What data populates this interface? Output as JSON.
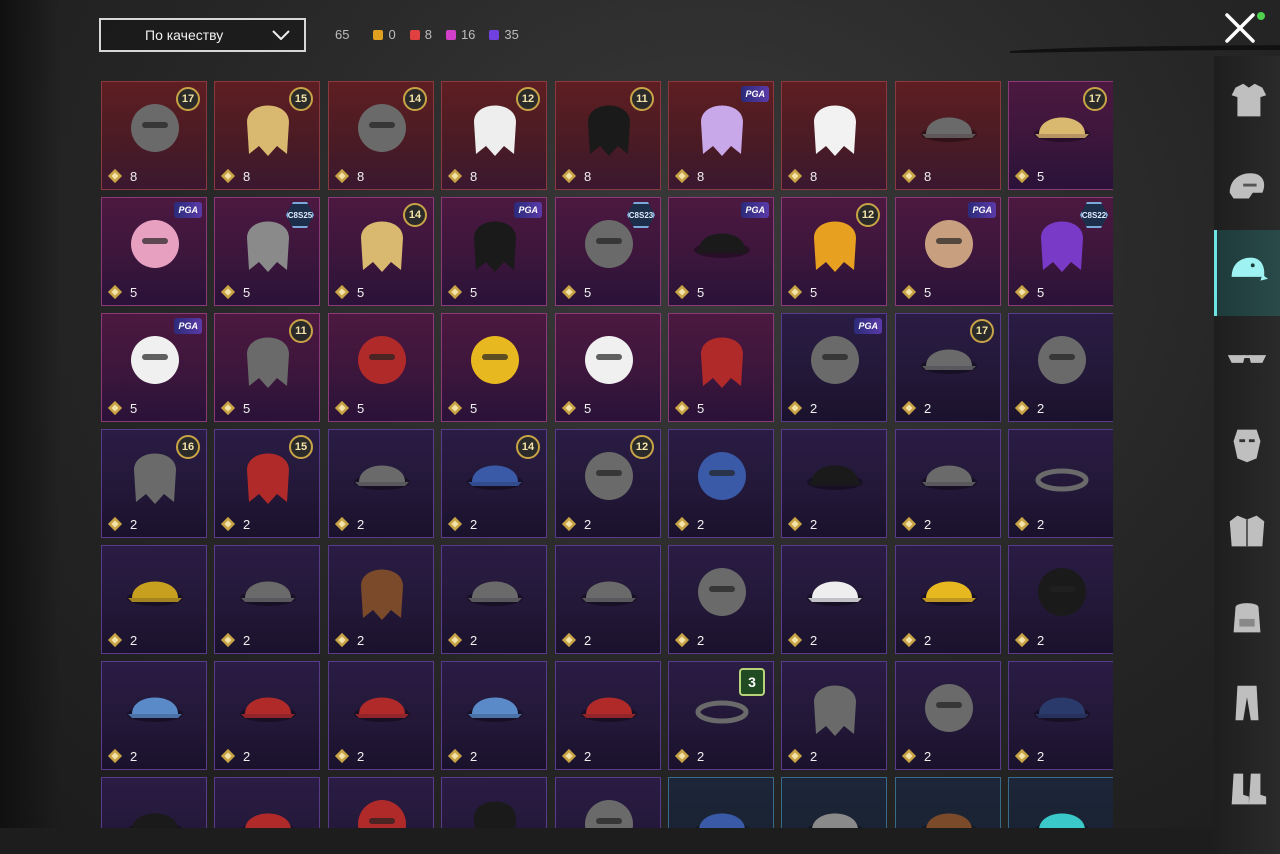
{
  "filter": {
    "sort_label": "По качеству"
  },
  "counts": {
    "total": "65",
    "legendary": {
      "value": "0",
      "color": "#e0a020"
    },
    "red": {
      "value": "8",
      "color": "#e04040"
    },
    "pink": {
      "value": "16",
      "color": "#d040c8"
    },
    "purple": {
      "value": "35",
      "color": "#7040e0"
    }
  },
  "sidebar": {
    "categories": [
      {
        "icon": "outfit-icon",
        "active": false
      },
      {
        "icon": "helmet-icon",
        "active": false
      },
      {
        "icon": "hat-icon",
        "active": true
      },
      {
        "icon": "sunglasses-icon",
        "active": false
      },
      {
        "icon": "mask-icon",
        "active": false
      },
      {
        "icon": "jacket-icon",
        "active": false
      },
      {
        "icon": "backpack-icon",
        "active": false
      },
      {
        "icon": "pants-icon",
        "active": false
      },
      {
        "icon": "shoes-icon",
        "active": false
      }
    ]
  },
  "items": [
    {
      "qty": "8",
      "tier": "red",
      "badge": "17",
      "badge_type": "level",
      "art": "horned-mask-hair"
    },
    {
      "qty": "8",
      "tier": "red",
      "badge": "15",
      "badge_type": "level",
      "art": "blonde-flower-hair"
    },
    {
      "qty": "8",
      "tier": "red",
      "badge": "14",
      "badge_type": "level",
      "art": "cat-ear-mask"
    },
    {
      "qty": "8",
      "tier": "red",
      "badge": "12",
      "badge_type": "level",
      "art": "white-long-hair"
    },
    {
      "qty": "8",
      "tier": "red",
      "badge": "11",
      "badge_type": "level",
      "art": "black-hair"
    },
    {
      "qty": "8",
      "tier": "red",
      "badge": "PGA",
      "badge_type": "tag",
      "art": "lilac-hair"
    },
    {
      "qty": "8",
      "tier": "red",
      "badge": "",
      "badge_type": "none",
      "art": "ghost-hood"
    },
    {
      "qty": "8",
      "tier": "red",
      "badge": "",
      "badge_type": "none",
      "art": "pirate-hat"
    },
    {
      "qty": "5",
      "tier": "pink",
      "badge": "17",
      "badge_type": "level",
      "art": "teal-cap-blonde"
    },
    {
      "qty": "5",
      "tier": "pink",
      "badge": "PGA",
      "badge_type": "tag",
      "art": "pink-bow-headband"
    },
    {
      "qty": "5",
      "tier": "pink",
      "badge": "C8S25",
      "badge_type": "hex",
      "art": "grey-bob-hair"
    },
    {
      "qty": "5",
      "tier": "pink",
      "badge": "14",
      "badge_type": "level",
      "art": "blonde-flower-hair"
    },
    {
      "qty": "5",
      "tier": "pink",
      "badge": "PGA",
      "badge_type": "tag",
      "art": "black-hair"
    },
    {
      "qty": "5",
      "tier": "pink",
      "badge": "C8S23",
      "badge_type": "hex",
      "art": "cat-headphones"
    },
    {
      "qty": "5",
      "tier": "pink",
      "badge": "PGA",
      "badge_type": "tag",
      "art": "black-cap-goggles"
    },
    {
      "qty": "5",
      "tier": "pink",
      "badge": "12",
      "badge_type": "level",
      "art": "orange-twin-tails"
    },
    {
      "qty": "5",
      "tier": "pink",
      "badge": "PGA",
      "badge_type": "tag",
      "art": "alpaca-mask"
    },
    {
      "qty": "5",
      "tier": "pink",
      "badge": "C8S22",
      "badge_type": "hex",
      "art": "purple-bob-hair"
    },
    {
      "qty": "5",
      "tier": "pink",
      "badge": "PGA",
      "badge_type": "tag",
      "art": "panda-head"
    },
    {
      "qty": "5",
      "tier": "pink",
      "badge": "11",
      "badge_type": "level",
      "art": "veil-flower-hair"
    },
    {
      "qty": "5",
      "tier": "pink",
      "badge": "",
      "badge_type": "none",
      "art": "red-fox-mask"
    },
    {
      "qty": "5",
      "tier": "pink",
      "badge": "",
      "badge_type": "none",
      "art": "orange-fruit"
    },
    {
      "qty": "5",
      "tier": "pink",
      "badge": "",
      "badge_type": "none",
      "art": "seagull-head"
    },
    {
      "qty": "5",
      "tier": "pink",
      "badge": "",
      "badge_type": "none",
      "art": "red-curly-hair"
    },
    {
      "qty": "2",
      "tier": "purple",
      "badge": "PGA",
      "badge_type": "tag",
      "art": "heart-headband"
    },
    {
      "qty": "2",
      "tier": "purple",
      "badge": "17",
      "badge_type": "level",
      "art": "steampunk-hat"
    },
    {
      "qty": "2",
      "tier": "purple",
      "badge": "",
      "badge_type": "none",
      "art": "goggle-helmets"
    },
    {
      "qty": "2",
      "tier": "purple",
      "badge": "16",
      "badge_type": "level",
      "art": "beanie-goggles"
    },
    {
      "qty": "2",
      "tier": "purple",
      "badge": "15",
      "badge_type": "level",
      "art": "red-long-hair"
    },
    {
      "qty": "2",
      "tier": "purple",
      "badge": "",
      "badge_type": "none",
      "art": "visor-hair"
    },
    {
      "qty": "2",
      "tier": "purple",
      "badge": "14",
      "badge_type": "level",
      "art": "blue-cap-long-hair"
    },
    {
      "qty": "2",
      "tier": "purple",
      "badge": "12",
      "badge_type": "level",
      "art": "bunny-ear-helmet"
    },
    {
      "qty": "2",
      "tier": "purple",
      "badge": "",
      "badge_type": "none",
      "art": "blue-helmet"
    },
    {
      "qty": "2",
      "tier": "purple",
      "badge": "",
      "badge_type": "none",
      "art": "black-cap"
    },
    {
      "qty": "2",
      "tier": "purple",
      "badge": "",
      "badge_type": "none",
      "art": "horned-cap"
    },
    {
      "qty": "2",
      "tier": "purple",
      "badge": "",
      "badge_type": "none",
      "art": "devil-horns"
    },
    {
      "qty": "2",
      "tier": "purple",
      "badge": "",
      "badge_type": "none",
      "art": "rasta-hat"
    },
    {
      "qty": "2",
      "tier": "purple",
      "badge": "",
      "badge_type": "none",
      "art": "witch-hat"
    },
    {
      "qty": "2",
      "tier": "purple",
      "badge": "",
      "badge_type": "none",
      "art": "brown-hair"
    },
    {
      "qty": "2",
      "tier": "purple",
      "badge": "",
      "badge_type": "none",
      "art": "striped-mushroom-hat"
    },
    {
      "qty": "2",
      "tier": "purple",
      "badge": "",
      "badge_type": "none",
      "art": "aviator-cap"
    },
    {
      "qty": "2",
      "tier": "purple",
      "badge": "",
      "badge_type": "none",
      "art": "football-helmet"
    },
    {
      "qty": "2",
      "tier": "purple",
      "badge": "",
      "badge_type": "none",
      "art": "white-visor"
    },
    {
      "qty": "2",
      "tier": "purple",
      "badge": "",
      "badge_type": "none",
      "art": "yellow-bucket-hat"
    },
    {
      "qty": "2",
      "tier": "purple",
      "badge": "",
      "badge_type": "none",
      "art": "black-helmet"
    },
    {
      "qty": "2",
      "tier": "purple",
      "badge": "",
      "badge_type": "none",
      "art": "shark-hat"
    },
    {
      "qty": "2",
      "tier": "purple",
      "badge": "",
      "badge_type": "none",
      "art": "red-beret"
    },
    {
      "qty": "2",
      "tier": "purple",
      "badge": "",
      "badge_type": "none",
      "art": "red-fedora"
    },
    {
      "qty": "2",
      "tier": "purple",
      "badge": "",
      "badge_type": "none",
      "art": "grey-shark-hat"
    },
    {
      "qty": "2",
      "tier": "purple",
      "badge": "",
      "badge_type": "none",
      "art": "red-bucket-hat"
    },
    {
      "qty": "2",
      "tier": "purple",
      "badge": "3",
      "badge_type": "green",
      "art": "flower-wreath"
    },
    {
      "qty": "2",
      "tier": "purple",
      "badge": "",
      "badge_type": "none",
      "art": "knit-beanie"
    },
    {
      "qty": "2",
      "tier": "purple",
      "badge": "",
      "badge_type": "none",
      "art": "head-mirror"
    },
    {
      "qty": "2",
      "tier": "purple",
      "badge": "",
      "badge_type": "none",
      "art": "navy-garrison-cap"
    },
    {
      "qty": "",
      "tier": "purple",
      "badge": "",
      "badge_type": "none",
      "art": "black-cap"
    },
    {
      "qty": "",
      "tier": "purple",
      "badge": "",
      "badge_type": "none",
      "art": "red-beret"
    },
    {
      "qty": "",
      "tier": "purple",
      "badge": "",
      "badge_type": "none",
      "art": "checkered-helmet"
    },
    {
      "qty": "",
      "tier": "purple",
      "badge": "",
      "badge_type": "none",
      "art": "black-bandana"
    },
    {
      "qty": "",
      "tier": "purple",
      "badge": "",
      "badge_type": "none",
      "art": "skull-helmet"
    },
    {
      "qty": "",
      "tier": "blue",
      "badge": "",
      "badge_type": "none",
      "art": "blue-cap"
    },
    {
      "qty": "",
      "tier": "blue",
      "badge": "",
      "badge_type": "none",
      "art": "grey-cap"
    },
    {
      "qty": "",
      "tier": "blue",
      "badge": "",
      "badge_type": "none",
      "art": "brown-cap"
    },
    {
      "qty": "",
      "tier": "blue",
      "badge": "",
      "badge_type": "none",
      "art": "teal-cap"
    }
  ]
}
